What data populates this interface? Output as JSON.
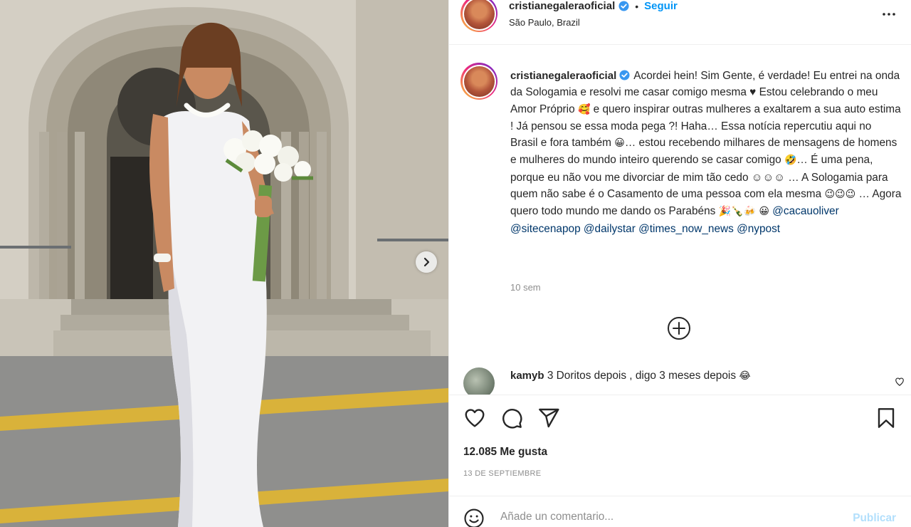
{
  "post": {
    "username": "cristianegaleraoficial",
    "follow_label": "Seguir",
    "dot": "•",
    "location": "São Paulo, Brazil",
    "caption_parts": [
      "Acordei hein! Sim Gente, é verdade! Eu entrei na onda da Sologamia e resolvi me casar comigo mesma ♥ Estou celebrando o meu Amor Próprio ",
      "🥰",
      " e quero inspirar outras mulheres a exaltarem a sua auto estima ! Já pensou se essa moda pega ?! Haha… Essa notícia repercutiu aqui no Brasil e fora também ",
      "😀",
      "… estou recebendo milhares de mensagens de homens e mulheres do mundo inteiro querendo se casar comigo ",
      "🤣",
      "… É uma pena, porque eu não vou me divorciar de mim tão cedo ☺☺☺ … A Sologamia para quem não sabe é o Casamento de uma pessoa com ela mesma ",
      "😉😉😉",
      " … Agora quero todo mundo me dando os Parabéns ",
      "🎉🍾🍻 😀",
      " "
    ],
    "mentions": [
      "@cacauoliver",
      "@sitecenapop",
      "@dailystar",
      "@times_now_news",
      "@nypost"
    ],
    "time_ago": "10 sem",
    "comment": {
      "username": "kamyb",
      "text": "3 Doritos depois , digo 3 meses depois",
      "emoji": "😂"
    },
    "likes": "12.085 Me gusta",
    "date": "13 de septiembre",
    "add_comment": {
      "placeholder": "Añade un comentario...",
      "publish_label": "Publicar"
    }
  },
  "icons": [
    "verified-icon",
    "more-icon",
    "load-more-icon",
    "heart-icon",
    "comment-icon",
    "share-icon",
    "save-icon",
    "smile-icon",
    "next-arrow-icon"
  ],
  "colors": {
    "link_blue": "#0095f6",
    "mention_blue": "#00376b",
    "muted": "#8e8e8e",
    "text": "#262626"
  }
}
